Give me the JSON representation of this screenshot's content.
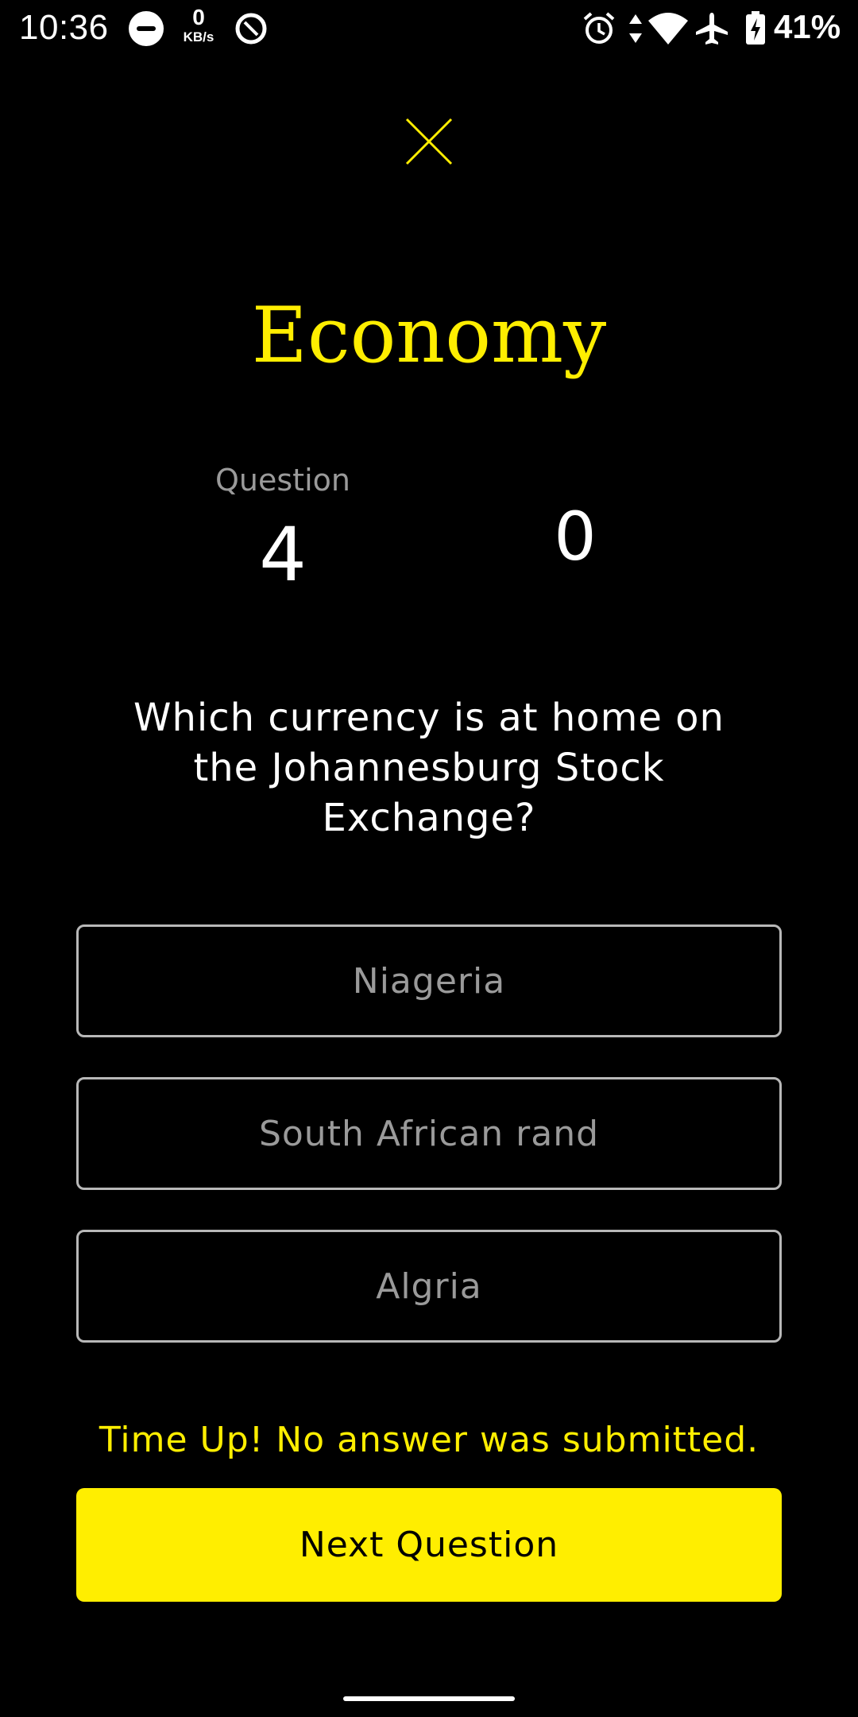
{
  "status_bar": {
    "time": "10:36",
    "net_speed_value": "0",
    "net_speed_unit": "KB/s",
    "battery_percent": "41%",
    "icons": [
      "notification-icon",
      "sync-icon",
      "alarm-icon",
      "data-arrows-icon",
      "wifi-icon",
      "airplane-icon",
      "battery-charging-icon"
    ]
  },
  "quiz": {
    "close_icon": "close-icon",
    "category": "Economy",
    "question_label": "Question",
    "question_number": "4",
    "score": "0",
    "question_text": "Which currency is at home on the Johannesburg Stock Exchange?",
    "answers": [
      {
        "label": "Niageria"
      },
      {
        "label": "South African rand"
      },
      {
        "label": "Algria"
      }
    ],
    "feedback": "Time Up! No answer was submitted.",
    "next_button_label": "Next Question"
  },
  "colors": {
    "background": "#000000",
    "accent": "#ffee00",
    "text": "#ffffff",
    "muted": "#9a9a9a",
    "border": "#b8b8b8"
  }
}
